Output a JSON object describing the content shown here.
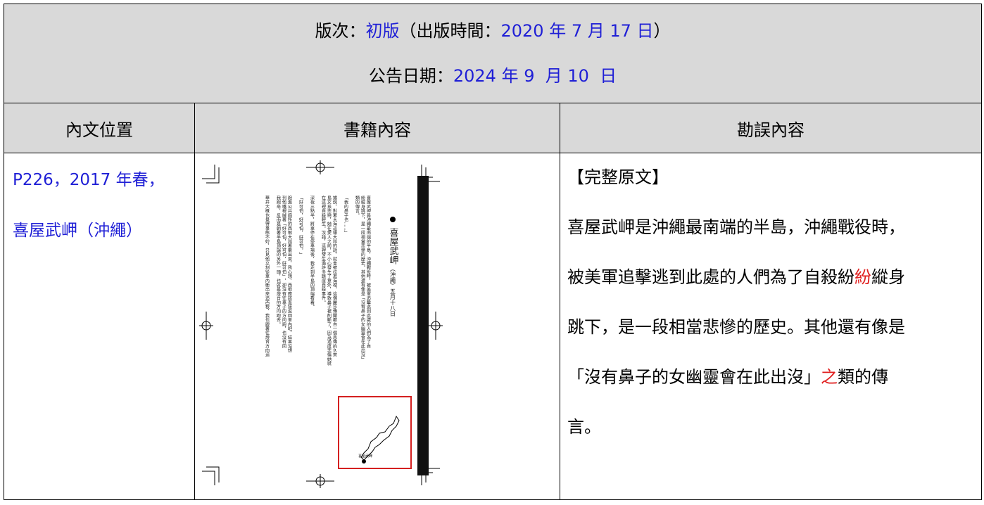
{
  "header": {
    "edition_label": "版次：",
    "edition_value": "初版",
    "pub_open": "（出版時間：",
    "pub_date": "2020 年 7 月 17 日",
    "pub_close": "）",
    "notice_label": "公告日期：",
    "notice_date": "2024 年 9  月 10  日"
  },
  "columns": {
    "position": "內文位置",
    "book": "書籍內容",
    "errata": "勘誤內容"
  },
  "row": {
    "position_line1": "P226，2017 年春，",
    "position_line2": "喜屋武岬（沖繩）",
    "book_scan": {
      "title": "喜屋武岬",
      "subtitle": "（沖繩）五月十八日",
      "map_label": "喜屋武岬",
      "columns": [
        "喜屋武岬是沖繩最南端的半島，沖繩戰役時，被美軍追擊逃到此處的人們為了自",
        "紛縱身跳下，是一段相當悲慘的歷史。其他還有像是「沒有鼻子的女幽靈會在此出沒」",
        "類的傳言。",
        "「我的鼻子也……」",
        "據說，對著大海這樣大叫的話，就會被拉進海裡。這個麗莎傳聞都自一個悲傳的久來",
        "島女孩悲戀，她在愛人之前，不小心發生了意外，導致鼻子被削斷了，因為過度悲傷她就",
        "在這裡自殺輕生。沒錯，這裡發生過許多跳崖自殺事件。",
        "深夜三點半，將車停在停車場後，我走到半島的頂端看看。",
        "「好可怕，好可怕，好可怕。」",
        "跑進公共廁所的西根大叫著衝出來，我心想，西根應該直接返回車內吧，結果沒想",
        "到他嘴裡喊著「好可怕，好可怕，好可怕」，卻沒有往車子的方向跑，也沒有回",
        "我跑來，反而是朝著半島頂端的另外一頭，也就是燈台的方向跑去。",
        "華井大概也覺得事態不妙，只見他立刻從車內衝出來追西根，我也跟著往燈台方向追"
      ]
    },
    "errata_heading": "【完整原文】",
    "errata_lines": [
      "喜屋武岬是沖繩最南端的半島，沖繩戰役時，",
      "被美軍追擊逃到此處的人們為了自殺紛",
      "紛",
      "縱身",
      "跳下，是一段相當悲慘的歷史。其他還有像是",
      "「沒有鼻子的女幽靈會在此出沒」",
      "之",
      "類的傳",
      "言。"
    ]
  },
  "colors": {
    "header_bg": "#d9d9d9",
    "blue_text": "#1f1fd6",
    "red_text": "#e02020",
    "highlight_box": "#d42020"
  }
}
